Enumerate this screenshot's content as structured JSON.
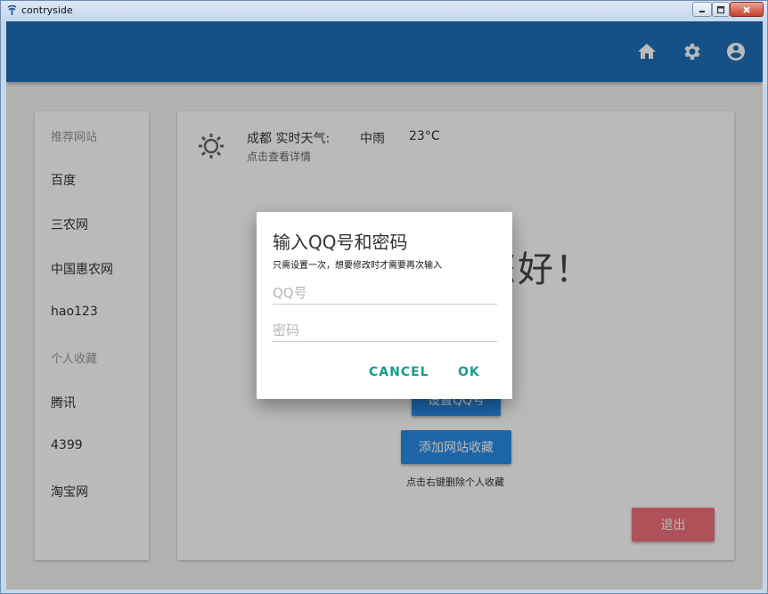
{
  "window": {
    "title": "contryside"
  },
  "appbar": {
    "icons": [
      "home-icon",
      "gear-icon",
      "account-circle-icon"
    ],
    "color": "#1e6eb9"
  },
  "sidebar": {
    "sections": [
      {
        "header": "推荐网站",
        "items": [
          "百度",
          "三农网",
          "中国惠农网",
          "hao123"
        ]
      },
      {
        "header": "个人收藏",
        "items": [
          "腾讯",
          "4399",
          "淘宝网"
        ]
      }
    ]
  },
  "weather": {
    "location_label": "成都 实时天气:",
    "condition": "中雨",
    "temperature": "23°C",
    "details_link": "点击查看详情"
  },
  "main": {
    "greeting": "您好！",
    "set_qq_button": "设置QQ号",
    "add_site_button": "添加网站收藏",
    "hint": "点击右键删除个人收藏",
    "exit_button": "退出"
  },
  "dialog": {
    "title": "输入QQ号和密码",
    "subtitle": "只需设置一次，想要修改时才需要再次输入",
    "qq_placeholder": "QQ号",
    "password_placeholder": "密码",
    "cancel_label": "CANCEL",
    "ok_label": "OK"
  }
}
